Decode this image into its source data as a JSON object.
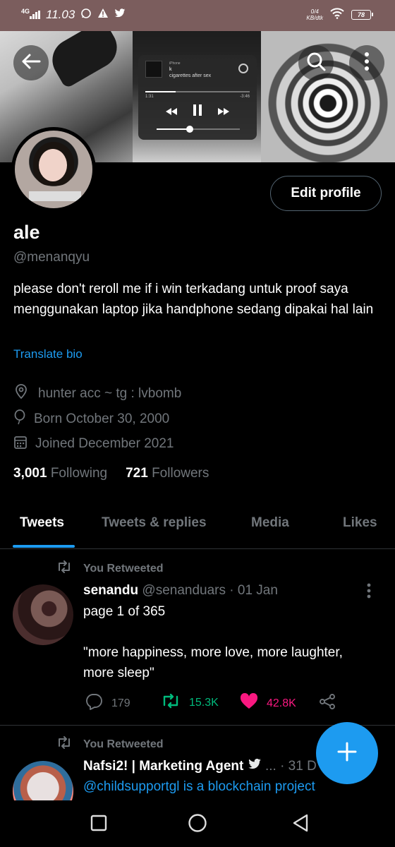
{
  "status_bar": {
    "network": "4G",
    "time": "11.03",
    "speed_value": "0/4",
    "speed_unit": "KB/dtk",
    "battery": "78",
    "icons": [
      "whatsapp-icon",
      "warning-icon",
      "twitter-icon",
      "wifi-icon",
      "battery-icon"
    ]
  },
  "banner": {
    "music_app": "iPhone",
    "song_title": "k",
    "song_artist": "cigarettes after sex",
    "time_elapsed": "1:31",
    "time_remaining": "-3:46",
    "playback_progress": 0.29,
    "volume_level": 0.4
  },
  "profile": {
    "name": "ale",
    "handle": "@menanqyu",
    "edit_label": "Edit profile",
    "bio": "please don't reroll me if i win terkadang untuk proof saya menggunakan laptop jika handphone sedang dipakai hal lain",
    "translate_label": "Translate bio",
    "location": "hunter acc ~ tg : lvbomb",
    "birthday": "Born October 30, 2000",
    "joined": "Joined December 2021",
    "following_count": "3,001",
    "following_label": "Following",
    "followers_count": "721",
    "followers_label": "Followers"
  },
  "tabs": [
    "Tweets",
    "Tweets & replies",
    "Media",
    "Likes"
  ],
  "active_tab": "Tweets",
  "tweets": [
    {
      "retweet_label": "You Retweeted",
      "author_name": "senandu",
      "author_handle": "@senanduars",
      "date": "· 01 Jan",
      "text_line1": "page 1 of 365",
      "text_line2": "\"more happiness, more love, more laughter, more sleep\"",
      "replies": "179",
      "retweets": "15.3K",
      "likes": "42.8K"
    },
    {
      "retweet_label": "You Retweeted",
      "author_name": "Nafsi2! | Marketing Agent",
      "author_handle": "...",
      "date": "· 31 D",
      "text_line1": "@childsupportgl is a blockchain project"
    }
  ],
  "colors": {
    "accent": "#1d9bf0",
    "retweet_green": "#00ba7c",
    "like_pink": "#f91880",
    "status_bar": "#7b5d5d",
    "muted": "#71767b"
  }
}
